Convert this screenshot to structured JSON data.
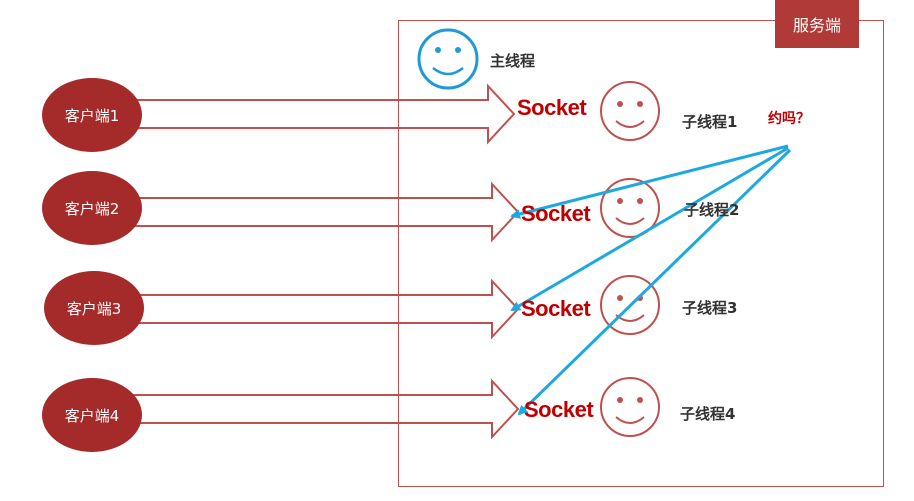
{
  "server": {
    "label": "服务端"
  },
  "main_thread": {
    "label": "主线程",
    "face": "smiley-face-icon"
  },
  "clients": [
    {
      "label": "客户端1"
    },
    {
      "label": "客户端2"
    },
    {
      "label": "客户端3"
    },
    {
      "label": "客户端4"
    }
  ],
  "sockets": [
    {
      "label": "Socket"
    },
    {
      "label": "Socket"
    },
    {
      "label": "Socket"
    },
    {
      "label": "Socket"
    }
  ],
  "threads": [
    {
      "label": "子线程1"
    },
    {
      "label": "子线程2"
    },
    {
      "label": "子线程3"
    },
    {
      "label": "子线程4"
    }
  ],
  "message": {
    "label": "约吗？"
  },
  "colors": {
    "client_fill": "#a52a2a",
    "server_tag": "#b03a37",
    "frame": "#c0504d",
    "socket_text": "#c00000",
    "thread_face": "#c0504d",
    "main_face": "#1e9ad6",
    "message_arrow": "#1ea8e0"
  }
}
